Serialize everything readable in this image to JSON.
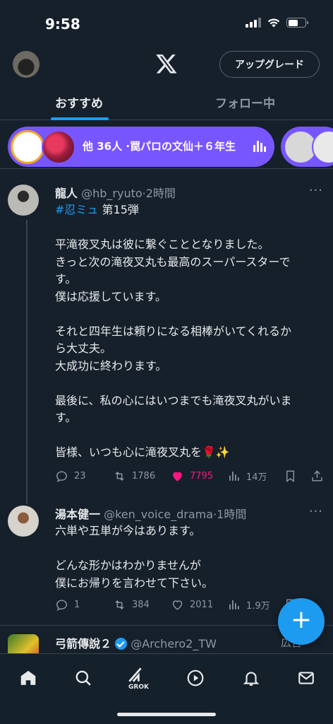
{
  "status_bar": {
    "time": "9:58"
  },
  "header": {
    "upgrade_label": "アップグレード"
  },
  "tabs": [
    {
      "label": "おすすめ",
      "active": true
    },
    {
      "label": "フォロー中",
      "active": false
    }
  ],
  "spaces": {
    "pill_text": "他 36人 ·罠パロの文仙＋６年生"
  },
  "tweets": [
    {
      "name": "龍人",
      "handle": "@hb_ryuto",
      "time": "·2時間",
      "hashtag": "#忍ミュ",
      "hashtag_suffix": " 第15弾",
      "lines": [
        "平滝夜叉丸は彼に繋ぐこととなりました。",
        "きっと次の滝夜叉丸も最高のスーパースターで",
        "す。",
        "僕は応援しています。",
        "",
        "それと四年生は頼りになる相棒がいてくれるか",
        "ら大丈夫。",
        "大成功に終わります。",
        "",
        "最後に、私の心にはいつまでも滝夜叉丸がいま",
        "す。",
        "",
        "皆様、いつも心に滝夜叉丸を🌹✨"
      ],
      "replies": "23",
      "reposts": "1786",
      "likes": "7795",
      "views": "14万"
    },
    {
      "name": "湯本健一",
      "handle": "@ken_voice_drama",
      "time": "·1時間",
      "lines": [
        "六単や五単が今はあります。",
        "",
        "どんな形かはわかりませんが",
        "僕にお帰りを言わせて下さい。"
      ],
      "replies": "1",
      "reposts": "384",
      "likes": "2011",
      "views": "1.9万"
    },
    {
      "name": "弓箭傳說２",
      "handle": "@Archero2_TW",
      "badge": "広告"
    }
  ],
  "bottom_nav": {
    "grok_label": "GROK"
  },
  "colors": {
    "accent": "#1d9bf0",
    "background": "#15202b",
    "spaces": "#7856ff",
    "like": "#f91880"
  }
}
